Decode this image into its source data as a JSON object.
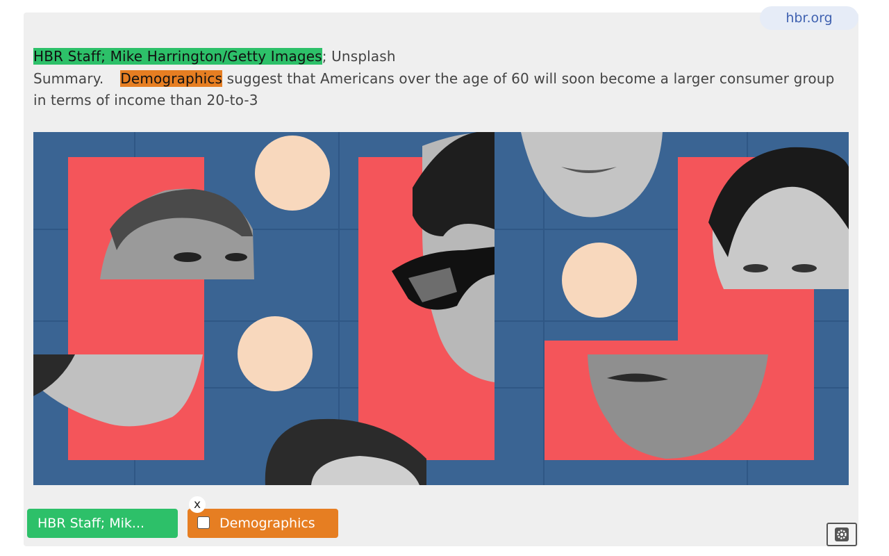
{
  "source": {
    "label": "hbr.org"
  },
  "credit": {
    "highlighted": "HBR Staff; Mike Harrington/Getty Images",
    "rest": "; Unsplash"
  },
  "summary": {
    "lead": "Summary.",
    "highlighted": "Demographics",
    "rest": " suggest that Americans over the age of 60 will soon become a larger consumer group in terms of income than 20-to-3"
  },
  "hero_image": {
    "description_icon": "collage-of-faces-image",
    "colors": {
      "background": "#3a6493",
      "red": "#f4555a",
      "circle": "#f8d8bd"
    }
  },
  "tags": [
    {
      "label": "HBR Staff; Mik...",
      "color": "#2dc069"
    },
    {
      "label": "Demographics",
      "color": "#e67e22",
      "close_label": "x"
    }
  ],
  "settings": {
    "icon": "gear-icon"
  }
}
